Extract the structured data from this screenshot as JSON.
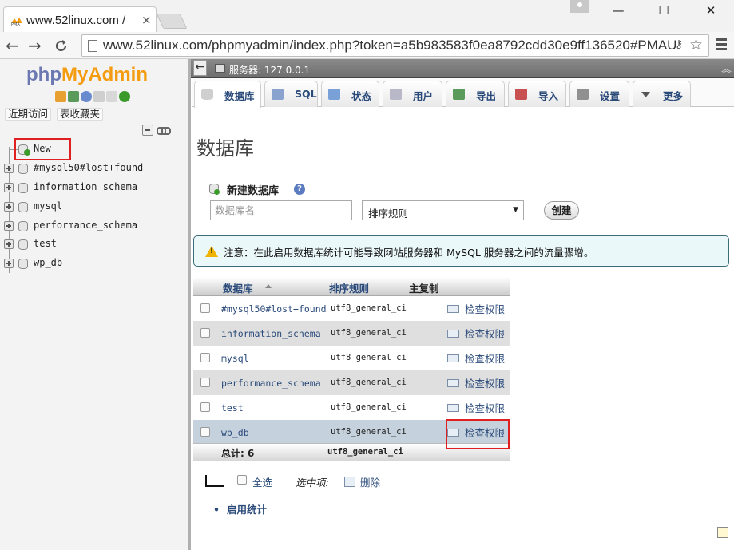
{
  "browser": {
    "tab_title": "www.52linux.com /",
    "tab_close": "×",
    "url": "www.52linux.com/phpmyadmin/index.php?token=a5b983583f0ea8792cdd30e9ff136520#PMAU",
    "window": {
      "minimize": "—",
      "maximize": "☐",
      "close": "✕"
    },
    "nav": {
      "back": "←",
      "forward": "→",
      "reload": "C"
    }
  },
  "sidebar": {
    "logo": {
      "php": "php",
      "my": "My",
      "admin": "Admin"
    },
    "tabs": {
      "recent": "近期访问",
      "favorites": "表收藏夹"
    },
    "tree": [
      {
        "label": "New"
      },
      {
        "label": "#mysql50#lost+found"
      },
      {
        "label": "information_schema"
      },
      {
        "label": "mysql"
      },
      {
        "label": "performance_schema"
      },
      {
        "label": "test"
      },
      {
        "label": "wp_db"
      }
    ]
  },
  "serverbar": {
    "label": "服务器: 127.0.0.1"
  },
  "menu": {
    "tabs": [
      {
        "label": "数据库",
        "icon": "database-icon",
        "color": "#cfcfcf"
      },
      {
        "label": "SQL",
        "icon": "sql-icon",
        "color": "#8aa4cf"
      },
      {
        "label": "状态",
        "icon": "status-icon",
        "color": "#7aa0d8"
      },
      {
        "label": "用户",
        "icon": "users-icon",
        "color": "#b8b8c8"
      },
      {
        "label": "导出",
        "icon": "export-icon",
        "color": "#5a9a5a"
      },
      {
        "label": "导入",
        "icon": "import-icon",
        "color": "#c85050"
      },
      {
        "label": "设置",
        "icon": "wrench-icon",
        "color": "#909090"
      },
      {
        "label": "更多",
        "icon": "chevron-down-icon",
        "color": "#555555"
      }
    ]
  },
  "main": {
    "title": "数据库",
    "create": {
      "heading": "新建数据库",
      "name_placeholder": "数据库名",
      "collation_value": "排序规则",
      "button": "创建"
    },
    "notice": "注意：在此启用数据库统计可能导致网站服务器和 MySQL 服务器之间的流量骤增。",
    "table": {
      "headers": {
        "database": "数据库",
        "collation": "排序规则",
        "replication": "主复制"
      },
      "rows": [
        {
          "name": "#mysql50#lost+found",
          "collation": "utf8_general_ci",
          "action": "检查权限"
        },
        {
          "name": "information_schema",
          "collation": "utf8_general_ci",
          "action": "检查权限"
        },
        {
          "name": "mysql",
          "collation": "utf8_general_ci",
          "action": "检查权限"
        },
        {
          "name": "performance_schema",
          "collation": "utf8_general_ci",
          "action": "检查权限"
        },
        {
          "name": "test",
          "collation": "utf8_general_ci",
          "action": "检查权限"
        },
        {
          "name": "wp_db",
          "collation": "utf8_general_ci",
          "action": "检查权限"
        }
      ],
      "total_label": "总计: 6",
      "total_collation": "utf8_general_ci"
    },
    "bulk": {
      "select_all": "全选",
      "with_selected": "选中项:",
      "delete": "删除"
    },
    "enable_stats": "启用统计"
  },
  "colors": {
    "highlight": "#e02020",
    "link": "#2a4a7a",
    "logo_php": "#6c78b2",
    "logo_myadmin": "#f49b0e"
  }
}
